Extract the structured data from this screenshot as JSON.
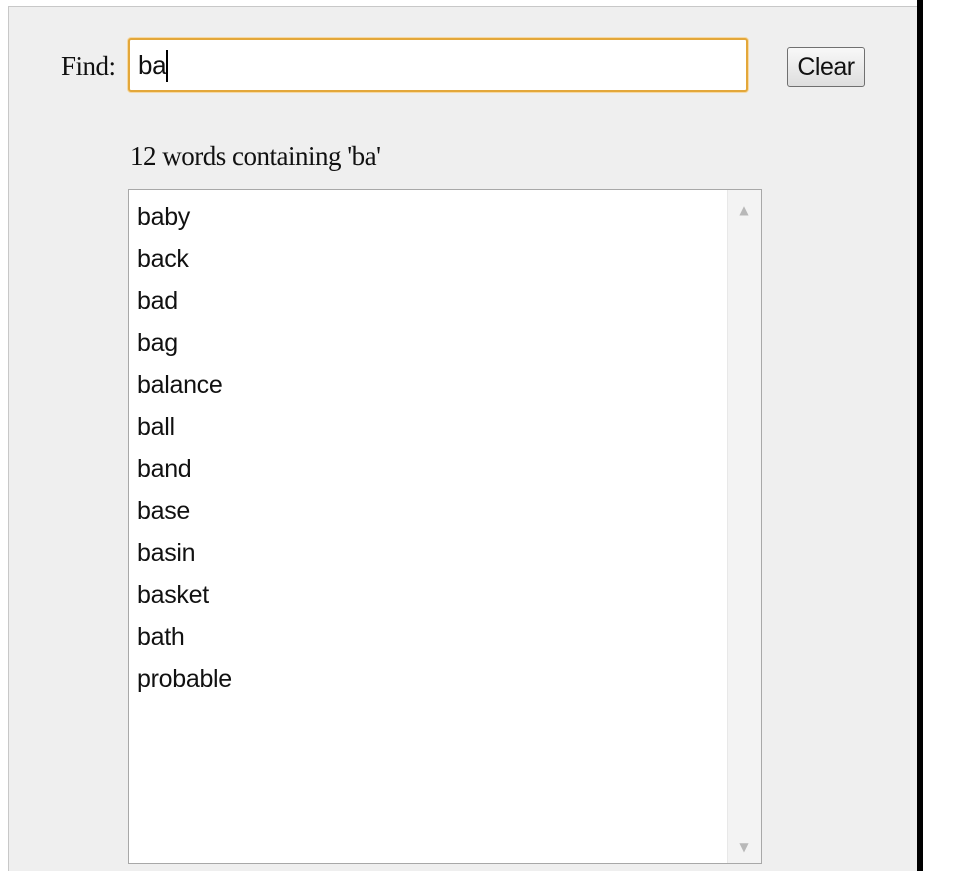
{
  "find": {
    "label": "Find:",
    "value": "ba"
  },
  "clear_button": {
    "label": "Clear"
  },
  "results": {
    "summary": "12 words containing 'ba'",
    "items": [
      "baby",
      "back",
      "bad",
      "bag",
      "balance",
      "ball",
      "band",
      "base",
      "basin",
      "basket",
      "bath",
      "probable"
    ]
  },
  "icons": {
    "scroll_up": "scroll-up-arrow-icon",
    "scroll_down": "scroll-down-arrow-icon"
  },
  "colors": {
    "input_focus_border": "#e3a73a",
    "panel_background": "#efefef"
  }
}
